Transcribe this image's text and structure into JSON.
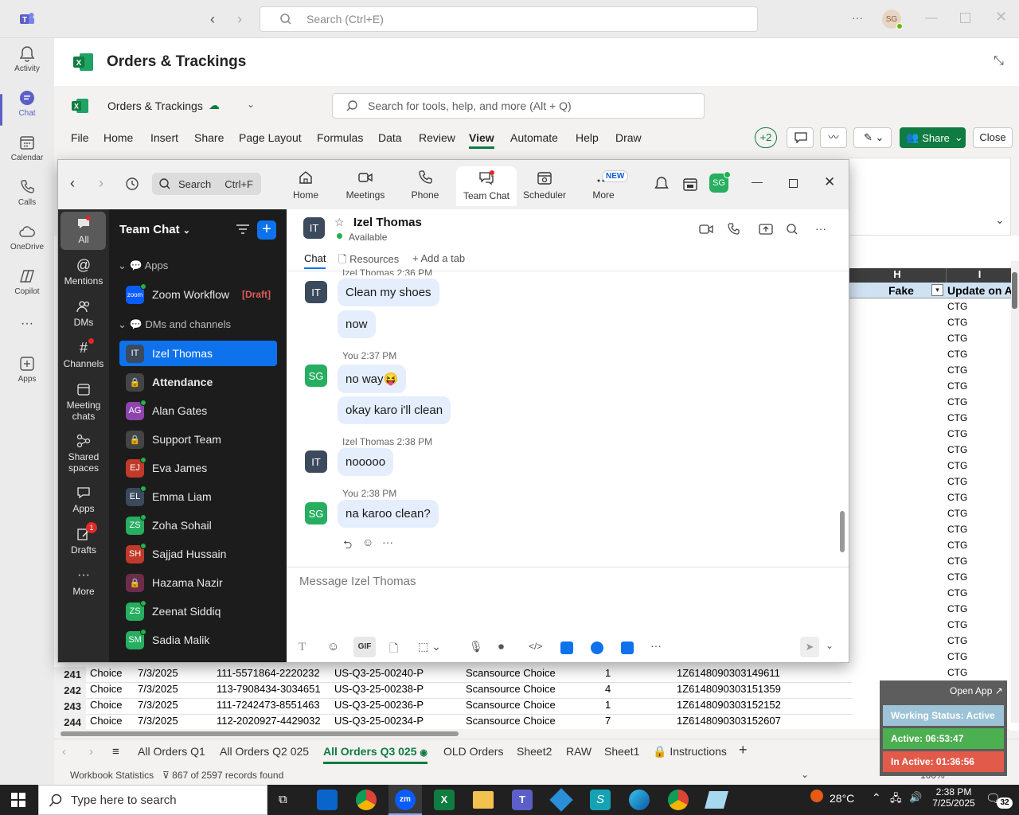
{
  "teams": {
    "search_placeholder": "Search (Ctrl+E)",
    "user_initials": "SG",
    "rail": [
      {
        "label": "Activity",
        "icon": "bell-icon"
      },
      {
        "label": "Chat",
        "icon": "chat-icon"
      },
      {
        "label": "Calendar",
        "icon": "calendar-icon"
      },
      {
        "label": "Calls",
        "icon": "phone-icon"
      },
      {
        "label": "OneDrive",
        "icon": "cloud-icon"
      },
      {
        "label": "Copilot",
        "icon": "copilot-icon"
      },
      {
        "label": "Apps",
        "icon": "add-app-icon"
      }
    ]
  },
  "excel": {
    "title": "Orders & Trackings",
    "workbook_name": "Orders & Trackings",
    "search_placeholder": "Search for tools, help, and more (Alt + Q)",
    "menu": [
      "File",
      "Home",
      "Insert",
      "Share",
      "Page Layout",
      "Formulas",
      "Data",
      "Review",
      "View",
      "Automate",
      "Help",
      "Draw"
    ],
    "selected_menu": "View",
    "collab_count": "+2",
    "share_label": "Share",
    "close_label": "Close",
    "col_h": "H",
    "col_i": "I",
    "hdr_fake": "Fake",
    "hdr_update": "Update on Ar",
    "ctg_label": "CTG",
    "rows": [
      {
        "num": "241",
        "b": "Choice",
        "date": "7/3/2025",
        "order": "111-5571864-2220232",
        "po": "US-Q3-25-00240-P",
        "vendor": "Scansource Choice",
        "qty": "1",
        "track": "1Z6148090303149611"
      },
      {
        "num": "242",
        "b": "Choice",
        "date": "7/3/2025",
        "order": "113-7908434-3034651",
        "po": "US-Q3-25-00238-P",
        "vendor": "Scansource Choice",
        "qty": "4",
        "track": "1Z6148090303151359"
      },
      {
        "num": "243",
        "b": "Choice",
        "date": "7/3/2025",
        "order": "111-7242473-8551463",
        "po": "US-Q3-25-00236-P",
        "vendor": "Scansource Choice",
        "qty": "1",
        "track": "1Z6148090303152152"
      },
      {
        "num": "244",
        "b": "Choice",
        "date": "7/3/2025",
        "order": "112-2020927-4429032",
        "po": "US-Q3-25-00234-P",
        "vendor": "Scansource Choice",
        "qty": "7",
        "track": "1Z6148090303152607"
      }
    ],
    "sheets": [
      "All Orders Q1",
      "All Orders Q2 025",
      "All Orders Q3 025",
      "OLD Orders",
      "Sheet2",
      "RAW",
      "Sheet1",
      "Instructions"
    ],
    "active_sheet": "All Orders Q3 025",
    "status_stats": "Workbook Statistics",
    "status_filter": "867 of 2597 records found",
    "zoom": "100%"
  },
  "zoom": {
    "search_label": "Search",
    "search_shortcut": "Ctrl+F",
    "nav": [
      {
        "label": "Home",
        "icon": "home-icon"
      },
      {
        "label": "Meetings",
        "icon": "video-icon"
      },
      {
        "label": "Phone",
        "icon": "phone-icon"
      },
      {
        "label": "Team Chat",
        "icon": "team-chat-icon"
      },
      {
        "label": "Scheduler",
        "icon": "scheduler-icon"
      },
      {
        "label": "More",
        "icon": "more-icon"
      }
    ],
    "new_badge": "NEW",
    "user_initials": "SG",
    "sidebar": [
      {
        "label": "All",
        "icon": "chat-bubble-icon"
      },
      {
        "label": "Mentions",
        "icon": "at-icon"
      },
      {
        "label": "DMs",
        "icon": "people-icon"
      },
      {
        "label": "Channels",
        "icon": "hash-icon"
      },
      {
        "label": "Meeting chats",
        "icon": "calendar-icon"
      },
      {
        "label": "Shared spaces",
        "icon": "share-nodes-icon"
      },
      {
        "label": "Apps",
        "icon": "apps-icon"
      },
      {
        "label": "Drafts",
        "icon": "edit-icon"
      },
      {
        "label": "More",
        "icon": "more-icon"
      }
    ],
    "drafts_badge": "1",
    "list_title": "Team Chat",
    "section_apps": "Apps",
    "app_item": {
      "name": "Zoom Workflow",
      "tag": "[Draft]",
      "logo": "zoom"
    },
    "section_dms": "DMs and channels",
    "contacts": [
      {
        "name": "Izel Thomas",
        "initials": "IT",
        "color": "#3b4a5c"
      },
      {
        "name": "Attendance",
        "initials": "",
        "color": "#444444"
      },
      {
        "name": "Alan Gates",
        "initials": "AG",
        "color": "#8e44ad"
      },
      {
        "name": "Support Team",
        "initials": "",
        "color": "#444444"
      },
      {
        "name": "Eva James",
        "initials": "EJ",
        "color": "#c0392b"
      },
      {
        "name": "Emma Liam",
        "initials": "EL",
        "color": "#3b4a5c"
      },
      {
        "name": "Zoha Sohail",
        "initials": "ZS",
        "color": "#27ae60"
      },
      {
        "name": "Sajjad Hussain",
        "initials": "SH",
        "color": "#c0392b"
      },
      {
        "name": "Hazama Nazir",
        "initials": "",
        "color": "#6d2c4a"
      },
      {
        "name": "Zeenat Siddiq",
        "initials": "ZS",
        "color": "#27ae60"
      },
      {
        "name": "Sadia Malik",
        "initials": "SM",
        "color": "#27ae60"
      }
    ],
    "chat": {
      "contact_name": "Izel Thomas",
      "contact_initials": "IT",
      "status": "Available",
      "tabs": [
        "Chat",
        "Resources",
        "Add a tab"
      ],
      "top_meta": "Izel Thomas 2:36 PM",
      "messages": [
        {
          "text": "Clean my shoes"
        },
        {
          "text": "now"
        },
        {
          "meta": "You 2:37 PM",
          "text": "no way😝"
        },
        {
          "text": "okay karo  i'll clean"
        },
        {
          "meta": "Izel Thomas 2:38 PM",
          "text": "nooooo"
        },
        {
          "meta": "You 2:38 PM",
          "text": "na karoo clean?"
        }
      ],
      "composer_placeholder": "Message Izel Thomas",
      "gif_label": "GIF"
    }
  },
  "widget": {
    "open_app": "Open App ↗",
    "working": "Working Status: Active",
    "active": "Active: 06:53:47",
    "inactive": "In Active: 01:36:56"
  },
  "taskbar": {
    "search_placeholder": "Type here to search",
    "temperature": "28°C",
    "time": "2:38 PM",
    "date": "7/25/2025",
    "notif_count": "32"
  }
}
